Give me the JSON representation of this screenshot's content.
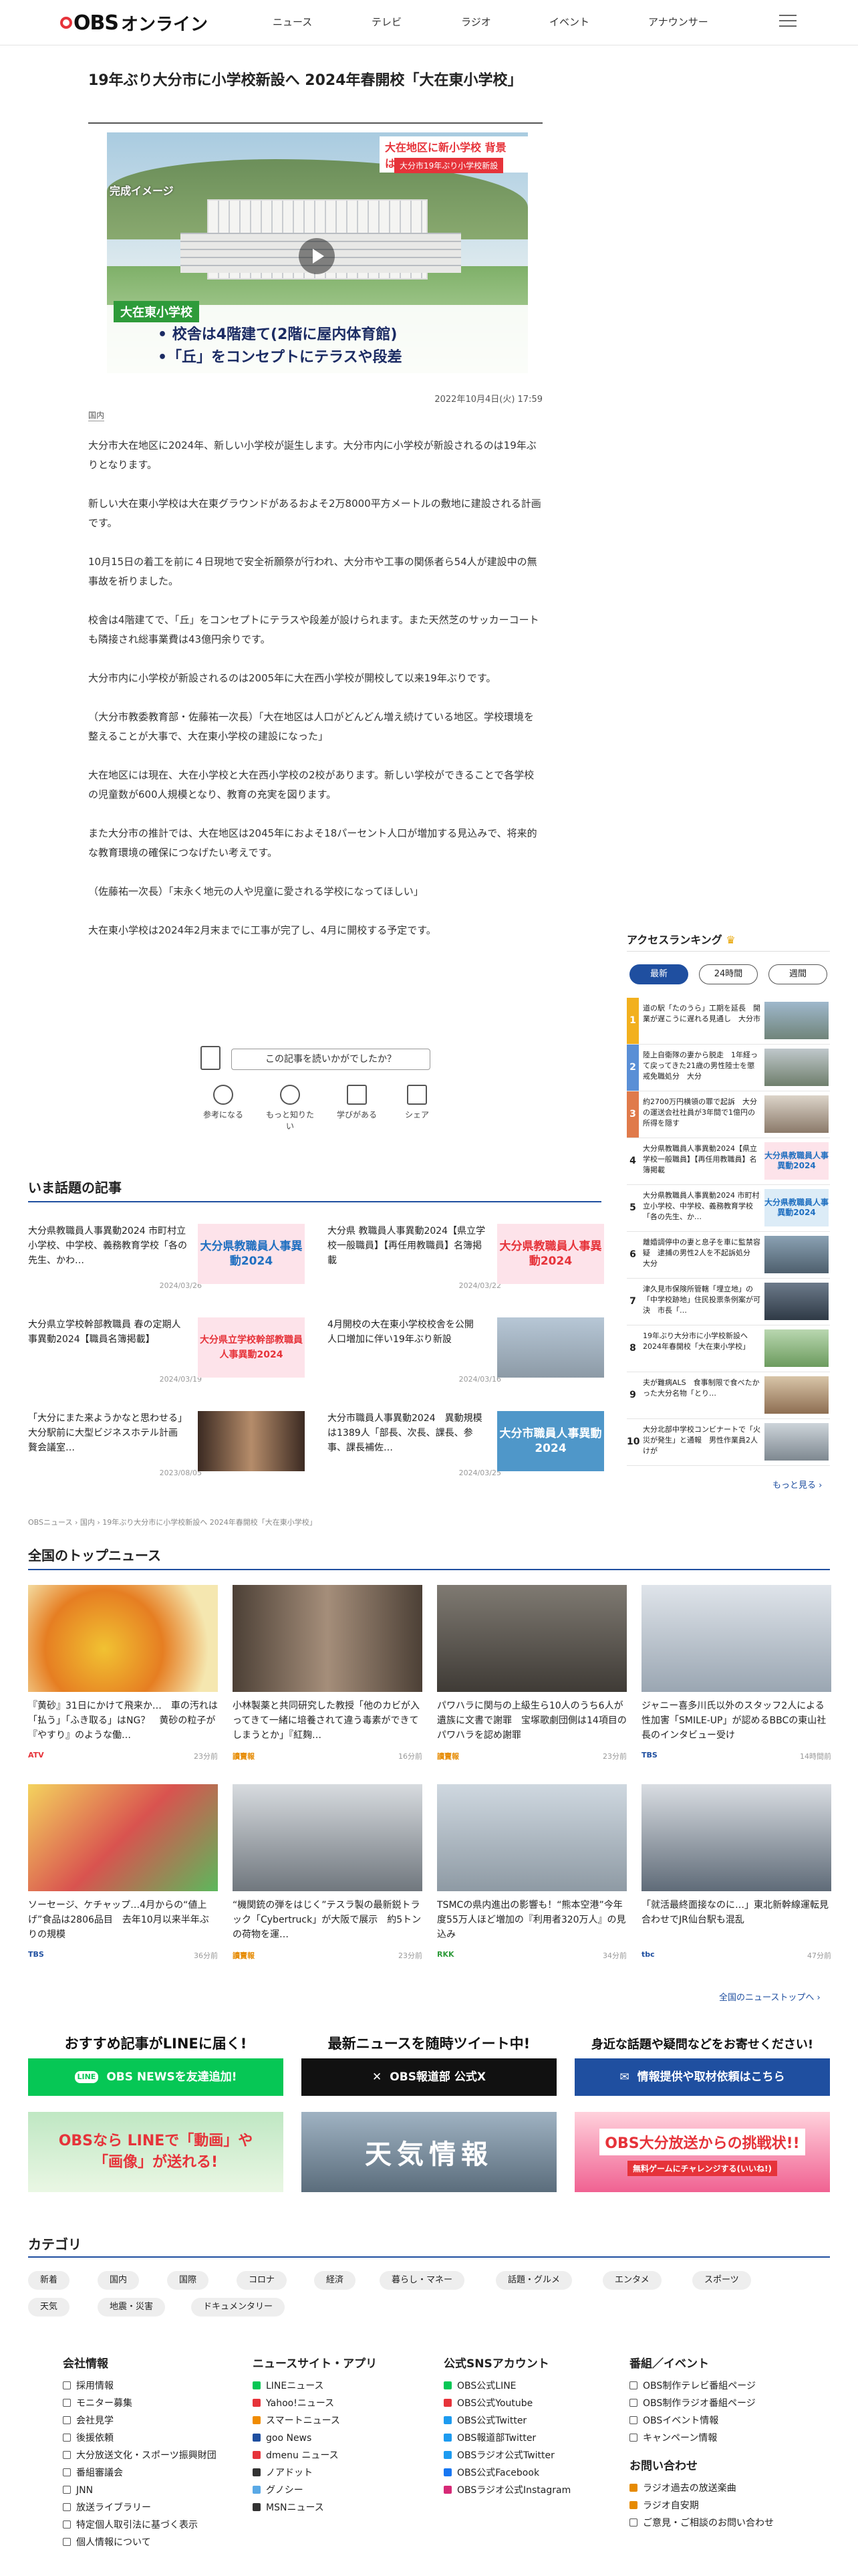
{
  "header": {
    "logo": "OBS",
    "logo_suffix": "オンライン",
    "nav": [
      "ニュース",
      "テレビ",
      "ラジオ",
      "イベント",
      "アナウンサー"
    ]
  },
  "article": {
    "title": "19年ぶり大分市に小学校新設へ 2024年春開校「大在東小学校」",
    "hero": {
      "corner_label": "完成イメージ",
      "headline_red": "大在地区に新小学校 背景は？",
      "headline_sub": "大分市19年ぶり小学校新設",
      "school_tag": "大在東小学校",
      "bullet1": "• 校舎は4階建て(2階に屋内体育館)",
      "bullet2": "•「丘」をコンセプトにテラスや段差"
    },
    "date": "2022年10月4日(火) 17:59",
    "category": "国内",
    "paragraphs": [
      "大分市大在地区に2024年、新しい小学校が誕生します。大分市内に小学校が新設されるのは19年ぶりとなります。",
      "新しい大在東小学校は大在東グラウンドがあるおよそ2万8000平方メートルの敷地に建設される計画です。",
      "10月15日の着工を前に４日現地で安全祈願祭が行われ、大分市や工事の関係者ら54人が建設中の無事故を祈りました。",
      "校舎は4階建てで、「丘」をコンセプトにテラスや段差が設けられます。また天然芝のサッカーコートも隣接され総事業費は43億円余りです。",
      "大分市内に小学校が新設されるのは2005年に大在西小学校が開校して以来19年ぶりです。",
      "（大分市教委教育部・佐藤祐一次長）「大在地区は人口がどんどん増え続けている地区。学校環境を整えることが大事で、大在東小学校の建設になった」",
      "大在地区には現在、大在小学校と大在西小学校の2校があります。新しい学校ができることで各学校の児童数が600人規模となり、教育の充実を図ります。",
      "また大分市の推計では、大在地区は2045年におよそ18パーセント人口が増加する見込みで、将来的な教育環境の確保につなげたい考えです。",
      "（佐藤祐一次長）「末永く地元の人や児童に愛される学校になってほしい」",
      "大在東小学校は2024年2月末までに工事が完了し、4月に開校する予定です。"
    ],
    "survey_button": "この記事を読いかがでしたか？",
    "reactions": [
      "参考になる",
      "もっと知りたい",
      "学びがある",
      "シェア"
    ]
  },
  "trending": {
    "heading": "いま話題の記事",
    "items": [
      {
        "title": "大分県教職員人事異動2024 市町村立小学校、中学校、義務教育学校「各の先生、かわ…",
        "date": "2024/03/26",
        "thumb": "大分県教職員人事異動2024"
      },
      {
        "title": "大分県 教職員人事異動2024【県立学校一般職員】【再任用教職員】名簿掲載",
        "date": "2024/03/22",
        "thumb": "大分県教職員人事異動2024"
      },
      {
        "title": "大分県立学校幹部教職員 春の定期人事異動2024【職員名簿掲載】",
        "date": "2024/03/19",
        "thumb": "大分県立学校幹部教職員人事異動2024"
      },
      {
        "title": "4月開校の大在東小学校校舎を公開　人口増加に伴い19年ぶり新設",
        "date": "2024/03/16",
        "thumb": ""
      },
      {
        "title": "「大分にまた来ようかなと思わせる」大分駅前に大型ビジネスホテル計画　贅会議室…",
        "date": "2023/08/05",
        "thumb": ""
      },
      {
        "title": "大分市職員人事異動2024　異動規模は1389人「部長、次長、課長、参事、課長補佐…",
        "date": "2024/03/25",
        "thumb": "大分市職員人事異動2024"
      }
    ]
  },
  "ranking": {
    "heading": "アクセスランキング",
    "tabs": [
      "最新",
      "24時間",
      "週間"
    ],
    "items": [
      {
        "title": "道の駅「たのうら」工期を延長　開業が遅こうに遅れる見通し　大分市",
        "thumb": ""
      },
      {
        "title": "陸上自衛隊の妻から脱走　1年経って戻ってきた21歳の男性陸士を懲戒免職処分　大分",
        "thumb": ""
      },
      {
        "title": "約2700万円横領の罪で起訴　大分の運送会社社員が3年間で1億円の所得を隠す",
        "thumb": ""
      },
      {
        "title": "大分県教職員人事異動2024【県立学校一般職員】【再任用教職員】名簿掲載",
        "thumb": "大分県教職員人事異動2024"
      },
      {
        "title": "大分県教職員人事異動2024 市町村立小学校、中学校、義務教育学校「各の先生、か…",
        "thumb": "大分県教職員人事異動2024"
      },
      {
        "title": "離婚調停中の妻と息子を車に監禁容疑　逮捕の男性2人を不起訴処分　大分",
        "thumb": ""
      },
      {
        "title": "津久見市保険所管轄「埋立地」の「中学校跡地」住民投票条例案が可決　市長「…",
        "thumb": ""
      },
      {
        "title": "19年ぶり大分市に小学校新設へ 2024年春開校「大在東小学校」",
        "thumb": ""
      },
      {
        "title": "夫が難病ALS　食事制限で食べたかった大分名物「とり…",
        "thumb": ""
      },
      {
        "title": "大分北部中学校コンビナートで「火災が発生」と通報　男性作業員2人けが",
        "thumb": ""
      }
    ],
    "more": "もっと見る ›"
  },
  "breadcrumb": "OBSニュース › 国内 › 19年ぶり大分市に小学校新設へ 2024年春開校「大在東小学校」",
  "top_news": {
    "heading": "全国のトップニュース",
    "items": [
      {
        "title": "『黄砂』31日にかけて飛来か…　車の汚れは「払う」「ふき取る」はNG？　黄砂の粒子が『やすり』のような働…",
        "source": "ATV",
        "time": "23分前"
      },
      {
        "title": "小林製薬と共同研究した教授「他のカビが入ってきて一緒に培養されて違う毒素ができてしまうとか」『紅麹…",
        "source": "讀賣報",
        "time": "16分前"
      },
      {
        "title": "パワハラに関与の上級生ら10人のうち6人が遺族に文書で謝罪　宝塚歌劇団側は14項目のパワハラを認め謝罪",
        "source": "讀賣報",
        "time": "23分前"
      },
      {
        "title": "ジャニー喜多川氏以外のスタッフ2人による性加害「SMILE-UP」が認めるBBCの東山社長のインタビュー受け",
        "source": "TBS",
        "time": "14時間前"
      },
      {
        "title": "ソーセージ、ケチャップ…4月からの“値上げ”食品は2806品目　去年10月以来半年ぶりの規模",
        "source": "TBS",
        "time": "36分前"
      },
      {
        "title": "“機関銃の弾をはじく”テスラ製の最新鋭トラック「Cybertruck」が大阪で展示　約5トンの荷物を運…",
        "source": "讀賣報",
        "time": "23分前"
      },
      {
        "title": "TSMCの県内進出の影響も！“熊本空港”今年度55万人ほど増加の『利用者320万人』の見込み",
        "source": "RKK",
        "time": "34分前"
      },
      {
        "title": "「就活最終面接なのに…」東北新幹線運転見合わせでJR仙台駅も混乱",
        "source": "tbc",
        "time": "47分前"
      }
    ],
    "more": "全国のニューストップへ ›"
  },
  "promos": [
    {
      "heading": "おすすめ記事がLINEに届く!",
      "button": "OBS NEWSを友達追加!",
      "color": "#06c755"
    },
    {
      "heading": "最新ニュースを随時ツイート中!",
      "button": "OBS報道部 公式X",
      "color": "#111111"
    },
    {
      "heading": "身近な話題や疑問などをお寄せください!",
      "button": "情報提供や取材依頼はこちら",
      "color": "#1f4fa0"
    }
  ],
  "banners": {
    "line": "OBSなら LINEで「動画」や「画像」が送れる!",
    "weather": "天気情報",
    "challenge": "OBS大分放送からの挑戦状!!",
    "challenge_sub": "無料ゲームにチャレンジする(いいね!)"
  },
  "categories": {
    "heading": "カテゴリ",
    "row1": [
      "新着",
      "国内",
      "国際",
      "コロナ",
      "経済",
      "暮らし・マネー",
      "話題・グルメ",
      "エンタメ",
      "スポーツ"
    ],
    "row2": [
      "天気",
      "地震・災害",
      "ドキュメンタリー"
    ]
  },
  "footer": {
    "col1": {
      "heading": "会社情報",
      "items": [
        "採用情報",
        "モニター募集",
        "会社見学",
        "後援依頼",
        "大分放送文化・スポーツ振興財団",
        "番組審議会",
        "JNN",
        "放送ライブラリー",
        "特定個人取引法に基づく表示",
        "個人情報について"
      ]
    },
    "col2": {
      "heading": "ニュースサイト・アプリ",
      "items": [
        "LINEニュース",
        "Yahoo!ニュース",
        "スマートニュース",
        "goo News",
        "dmenu ニュース",
        "ノアドット",
        "グノシー",
        "MSNニュース"
      ]
    },
    "col3": {
      "heading": "公式SNSアカウント",
      "items": [
        "OBS公式LINE",
        "OBS公式Youtube",
        "OBS公式Twitter",
        "OBS報道部Twitter",
        "OBSラジオ公式Twitter",
        "OBS公式Facebook",
        "OBSラジオ公式Instagram"
      ]
    },
    "col4": {
      "heading": "番組／イベント",
      "items": [
        "OBS制作テレビ番組ページ",
        "OBS制作ラジオ番組ページ",
        "OBSイベント情報",
        "キャンペーン情報"
      ]
    },
    "col5": {
      "heading": "お問い合わせ",
      "items": [
        "ラジオ過去の放送楽曲",
        "ラジオ自安期",
        "ご意見・ご相談のお問い合わせ"
      ]
    }
  },
  "colors": {
    "brand": "#1f4fa0",
    "accent": "#e6333a",
    "line_green": "#06c755"
  }
}
